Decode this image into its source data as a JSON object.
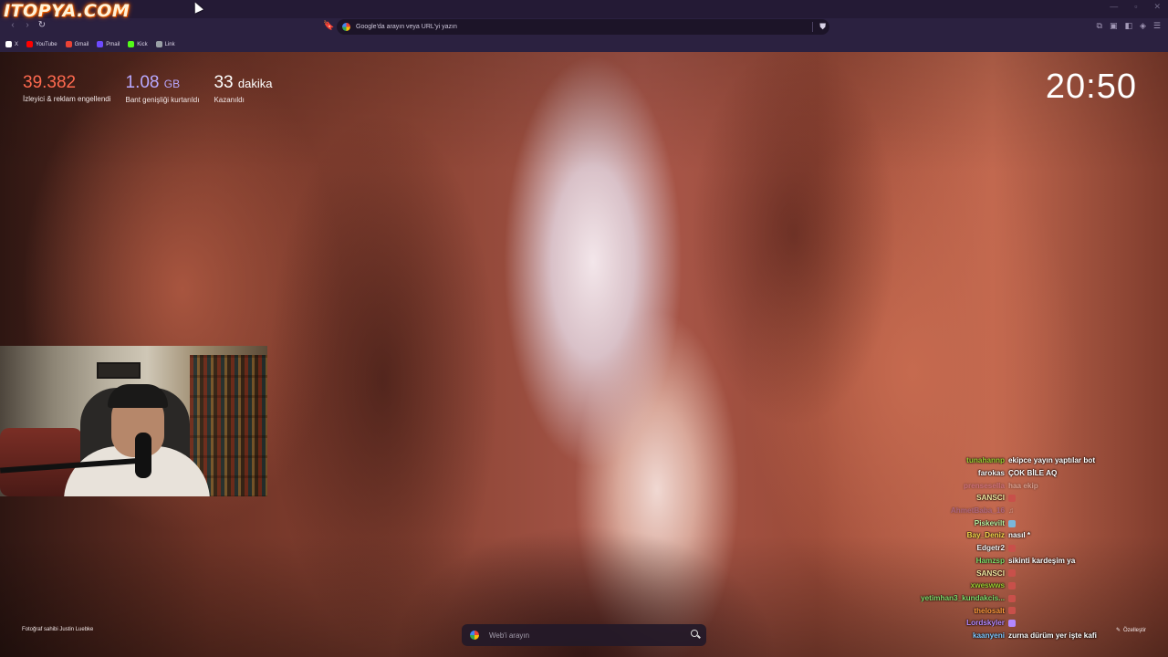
{
  "browser": {
    "overlay_logo": "ITOPYA.COM",
    "new_tab_symbol": "+",
    "window_controls": [
      "—",
      "▫",
      "✕"
    ],
    "nav": {
      "back": "‹",
      "forward": "›",
      "reload": "↻"
    },
    "omnibox": {
      "placeholder": "Google'da arayın veya URL'yi yazın"
    },
    "bookmarks": [
      {
        "label": "X",
        "icon": "x-icon",
        "color": "#ffffff"
      },
      {
        "label": "YouTube",
        "icon": "youtube-icon",
        "color": "#ff0000"
      },
      {
        "label": "Gmail",
        "icon": "gmail-icon",
        "color": "#ea4335"
      },
      {
        "label": "Pmail",
        "icon": "pmail-icon",
        "color": "#6d4aff"
      },
      {
        "label": "Kick",
        "icon": "kick-icon",
        "color": "#53fc18"
      },
      {
        "label": "Link",
        "icon": "link-icon",
        "color": "#9aa0a6"
      }
    ]
  },
  "stats": {
    "trackers": {
      "value": "39.382",
      "unit": "",
      "label": "İzleyici & reklam engellendi"
    },
    "bandwidth": {
      "value": "1.08",
      "unit": "GB",
      "label": "Bant genişliği kurtarıldı"
    },
    "time": {
      "value": "33",
      "unit": "dakika",
      "label": "Kazanıldı"
    }
  },
  "clock": "20:50",
  "photo_credit": "Fotoğraf sahibi Justin Luebke",
  "customize_label": "Özelleştir",
  "web_search": {
    "placeholder": "Web'i arayın"
  },
  "chat": [
    {
      "user": "tunahannp",
      "color": "#9acd32",
      "msg": "ekipce yayın yaptılar bot",
      "emote": false
    },
    {
      "user": "farokas",
      "color": "#f5f5f5",
      "msg": "ÇOK BİLE AQ",
      "emote": false
    },
    {
      "user": "prensesella",
      "color": "#d97cc9",
      "msg": "haa ekip",
      "emote": false,
      "faded": true
    },
    {
      "user": "SANSCI",
      "color": "#f0e6a0",
      "msg": "",
      "emote": true,
      "emote_color": "#c8504a"
    },
    {
      "user": "AhmetBaba_16",
      "color": "#8a63d2",
      "msg": "♫",
      "emote": false,
      "faded": true
    },
    {
      "user": "Piskevilt",
      "color": "#b7f0a0",
      "msg": "",
      "emote": true,
      "emote_color": "#7bb7d9"
    },
    {
      "user": "Bay_Deniz",
      "color": "#f7d94c",
      "msg": "nasıl *",
      "emote": false
    },
    {
      "user": "Edgetr2",
      "color": "#f5f5f5",
      "msg": "",
      "emote": true,
      "emote_color": "#c8504a"
    },
    {
      "user": "Hamzsp",
      "color": "#7ddc6a",
      "msg": "sikinti kardeşim ya",
      "emote": false
    },
    {
      "user": "SANSCI",
      "color": "#f0e6a0",
      "msg": "",
      "emote": true,
      "emote_color": "#c8504a"
    },
    {
      "user": "xweswws",
      "color": "#9acd32",
      "msg": "",
      "emote": true,
      "emote_color": "#c8504a"
    },
    {
      "user": "yetimhan3_kundakcis...",
      "color": "#7ddc6a",
      "msg": "",
      "emote": true,
      "emote_color": "#c8504a"
    },
    {
      "user": "thelosalt",
      "color": "#ff9a3c",
      "msg": "",
      "emote": true,
      "emote_color": "#c8504a"
    },
    {
      "user": "Lordskyler",
      "color": "#b388ff",
      "msg": "",
      "emote": true,
      "emote_color": "#b388ff"
    },
    {
      "user": "kaanyeni",
      "color": "#7ec8ff",
      "msg": "zurna dürüm yer işte kafi",
      "emote": false
    }
  ]
}
